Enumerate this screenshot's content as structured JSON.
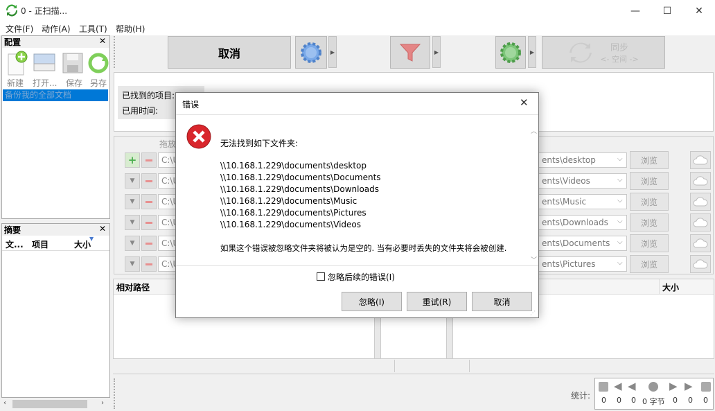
{
  "window": {
    "title": "0 - 正扫描...",
    "minimize": "—",
    "maximize": "☐",
    "close": "✕"
  },
  "menu": [
    "文件(F)",
    "动作(A)",
    "工具(T)",
    "帮助(H)"
  ],
  "config_panel": {
    "title": "配置",
    "close": "✕",
    "tools": [
      "新建",
      "打开...",
      "保存",
      "另存"
    ],
    "selected_item": "备份我的全部文档"
  },
  "summary_panel": {
    "title": "摘要",
    "close": "✕",
    "columns": [
      "文...",
      "项目",
      "大小"
    ]
  },
  "toolbar": {
    "cancel_label": "取消",
    "sync_title": "同步",
    "sync_subtitle": "<- 空间 ->"
  },
  "status": {
    "found_label": "已找到的项目:",
    "elapsed_label": "已用时间:"
  },
  "folders": {
    "drag_label": "拖放",
    "left_prefix": "C:\\U",
    "right": [
      "ents\\desktop",
      "ents\\Videos",
      "ents\\Music",
      "ents\\Downloads",
      "ents\\Documents",
      "ents\\Pictures"
    ],
    "browse_label": "浏览"
  },
  "results": {
    "col_path": "相对路径",
    "col_size": "大小"
  },
  "stats": {
    "label": "统计:",
    "values": [
      "0",
      "0",
      "0",
      "0 字节",
      "0",
      "0",
      "0"
    ]
  },
  "dialog": {
    "title": "错误",
    "close": "✕",
    "heading": "无法找到如下文件夹:",
    "paths": [
      "\\\\10.168.1.229\\documents\\desktop",
      "\\\\10.168.1.229\\documents\\Documents",
      "\\\\10.168.1.229\\documents\\Downloads",
      "\\\\10.168.1.229\\documents\\Music",
      "\\\\10.168.1.229\\documents\\Pictures",
      "\\\\10.168.1.229\\documents\\Videos"
    ],
    "note": "如果这个错误被忽略文件夹将被认为是空的. 当有必要时丢失的文件夹将会被创建.",
    "checkbox_label": "忽略后续的错误(I)",
    "ignore_label": "忽略(I)",
    "retry_label": "重试(R)",
    "cancel_label": "取消"
  }
}
